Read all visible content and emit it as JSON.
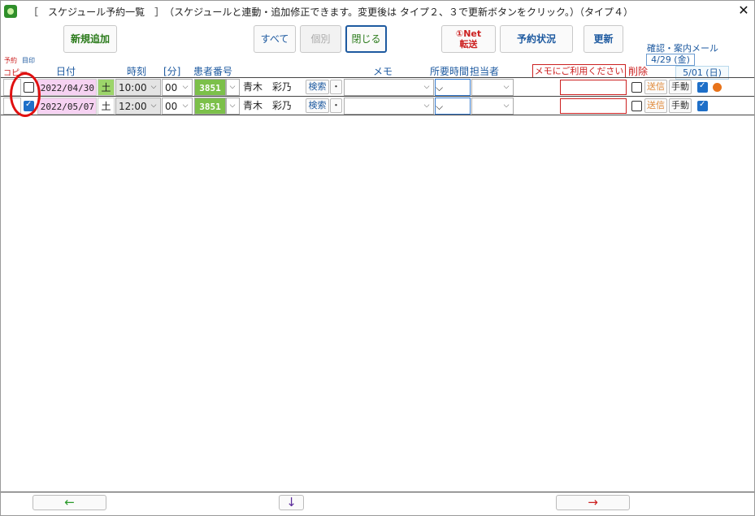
{
  "window": {
    "title": "［　スケジュール予約一覧　］　（スケジュールと連動・追加修正できます。変更後は タイプ２、３で更新ボタンをクリック。）（タイプ４）",
    "close_glyph": "✕"
  },
  "toolbar": {
    "new_label": "新規追加",
    "all_label": "すべて",
    "individual_label": "個別",
    "close_label": "閉じる",
    "net_transfer_line1": "①Net",
    "net_transfer_line2": "転送",
    "reservation_status_label": "予約状況",
    "update_label": "更新"
  },
  "mail_section": {
    "label": "確認・案内メール",
    "date1": "4/29 (金)",
    "date2": "5/01 (日)"
  },
  "headers": {
    "reservation": "予約",
    "mark": "目印",
    "copy": "コピー",
    "date": "日付",
    "time": "時刻",
    "minute": "[分]",
    "patient_no": "患者番号",
    "memo": "メモ",
    "duration": "所要時間",
    "staff": "担当者",
    "memo_note": "メモにご利用ください",
    "delete": "削除"
  },
  "rows": [
    {
      "marked": false,
      "date": "2022/04/30",
      "dow": "土",
      "time": "10:00",
      "minute": "00",
      "patient_no": "3851",
      "name": "青木　彩乃",
      "search_label": "検索",
      "dot_label": "・",
      "send_label": "送信",
      "manual_label": "手動",
      "mail_checked": true,
      "has_dot": true
    },
    {
      "marked": true,
      "date": "2022/05/07",
      "dow": "土",
      "time": "12:00",
      "minute": "00",
      "patient_no": "3851",
      "name": "青木　彩乃",
      "search_label": "検索",
      "dot_label": "・",
      "send_label": "送信",
      "manual_label": "手動",
      "mail_checked": true,
      "has_dot": false
    }
  ],
  "nav": {
    "left_arrow": "←",
    "down_arrow": "↓",
    "right_arrow": "→"
  },
  "colors": {
    "green_text": "#2a7a1a",
    "blue_text": "#1e5aa0",
    "red_text": "#cc2020",
    "sat_bg": "#9cd56a",
    "date_bg": "#f6d2f2",
    "patient_bg": "#7cc04a"
  },
  "icons": {
    "select_arrow": "⌵"
  }
}
